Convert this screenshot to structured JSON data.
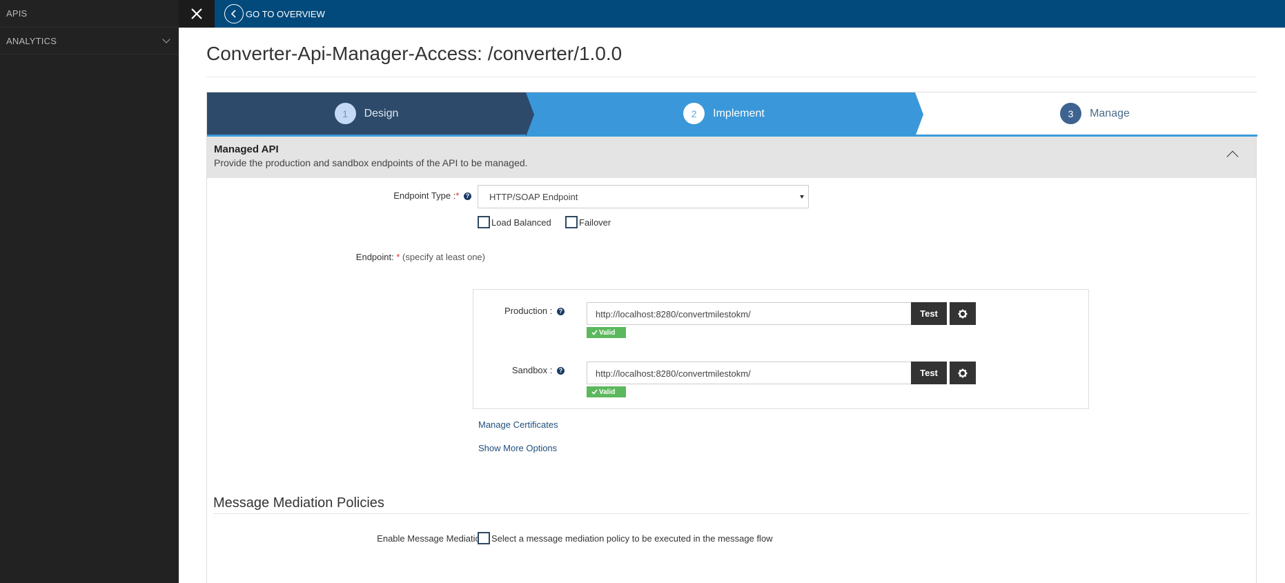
{
  "sidebar": {
    "items": [
      {
        "label": "APIS"
      },
      {
        "label": "ANALYTICS"
      }
    ]
  },
  "topbar": {
    "overview_label": "GO TO OVERVIEW"
  },
  "page": {
    "title": "Converter-Api-Manager-Access: /converter/1.0.0"
  },
  "wizard": {
    "steps": [
      {
        "num": "1",
        "label": "Design"
      },
      {
        "num": "2",
        "label": "Implement"
      },
      {
        "num": "3",
        "label": "Manage"
      }
    ]
  },
  "section": {
    "title": "Managed API",
    "description": "Provide the production and sandbox endpoints of the API to be managed."
  },
  "form": {
    "endpoint_type_label": "Endpoint Type :",
    "required_mark": "*",
    "endpoint_type_value": "HTTP/SOAP Endpoint",
    "load_balanced_label": "Load Balanced",
    "failover_label": "Failover",
    "endpoint_label": "Endpoint:",
    "endpoint_hint": "(specify at least one)",
    "production_label": "Production :",
    "production_url": "http://localhost:8280/convertmilestokm/",
    "sandbox_label": "Sandbox :",
    "sandbox_url": "http://localhost:8280/convertmilestokm/",
    "test_label": "Test",
    "valid_label": "Valid",
    "manage_certificates": "Manage Certificates",
    "show_more_options": "Show More Options"
  },
  "mediation": {
    "title": "Message Mediation Policies",
    "enable_label": "Enable Message Mediation",
    "checkbox_text": "Select a message mediation policy to be executed in the message flow"
  },
  "colors": {
    "sidebar_bg": "#222222",
    "topbar_bg": "#024a7c",
    "step_design": "#2d4a6a",
    "step_implement": "#3a97d9",
    "valid_green": "#5cb85c"
  }
}
